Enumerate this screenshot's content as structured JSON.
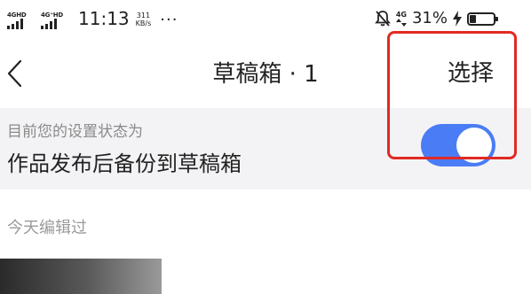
{
  "status_bar": {
    "sim1_label": "4GHD",
    "sim2_label": "4G⁺HD",
    "time": "11:13",
    "net_speed_value": "311",
    "net_speed_unit": "KB/s",
    "more_dots": "···",
    "net_type_right": "4G",
    "battery_percent": "31%",
    "battery_level": 0.31,
    "icons": [
      "signal-icon",
      "mute-icon",
      "signal-arrows-icon",
      "charging-icon",
      "battery-icon"
    ]
  },
  "nav": {
    "title": "草稿箱 · 1",
    "select_label": "选择",
    "back_icon": "chevron-left-icon"
  },
  "setting": {
    "caption": "目前您的设置状态为",
    "label": "作品发布后备份到草稿箱",
    "toggle_on": true
  },
  "section": {
    "header": "今天编辑过"
  },
  "colors": {
    "toggle_on": "#4a7cf5",
    "highlight": "#e02a23",
    "row_background": "#f3f3f5"
  }
}
